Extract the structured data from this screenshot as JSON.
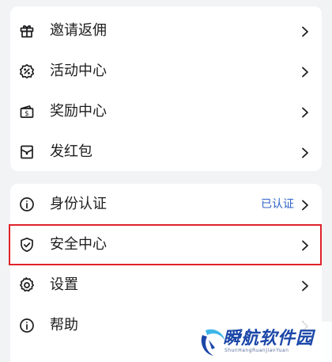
{
  "menu_group_1": {
    "items": [
      {
        "label": "邀请返佣",
        "icon": "gift-icon"
      },
      {
        "label": "活动中心",
        "icon": "activity-badge-icon"
      },
      {
        "label": "奖励中心",
        "icon": "reward-wallet-icon"
      },
      {
        "label": "发红包",
        "icon": "red-packet-icon"
      }
    ]
  },
  "menu_group_2": {
    "items": [
      {
        "label": "身份认证",
        "icon": "info-icon",
        "status": "已认证"
      },
      {
        "label": "安全中心",
        "icon": "shield-check-icon"
      },
      {
        "label": "设置",
        "icon": "gear-icon"
      },
      {
        "label": "帮助",
        "icon": "info-icon"
      }
    ]
  },
  "watermark": {
    "title": "瞬航软件园",
    "subtitle": "ShunHangRuanJianYuan"
  },
  "colors": {
    "background": "#f2f3f5",
    "card": "#ffffff",
    "text": "#1d1d1f",
    "status": "#2f63c6",
    "highlight": "#e0232b",
    "watermark": "#1b47a8"
  }
}
